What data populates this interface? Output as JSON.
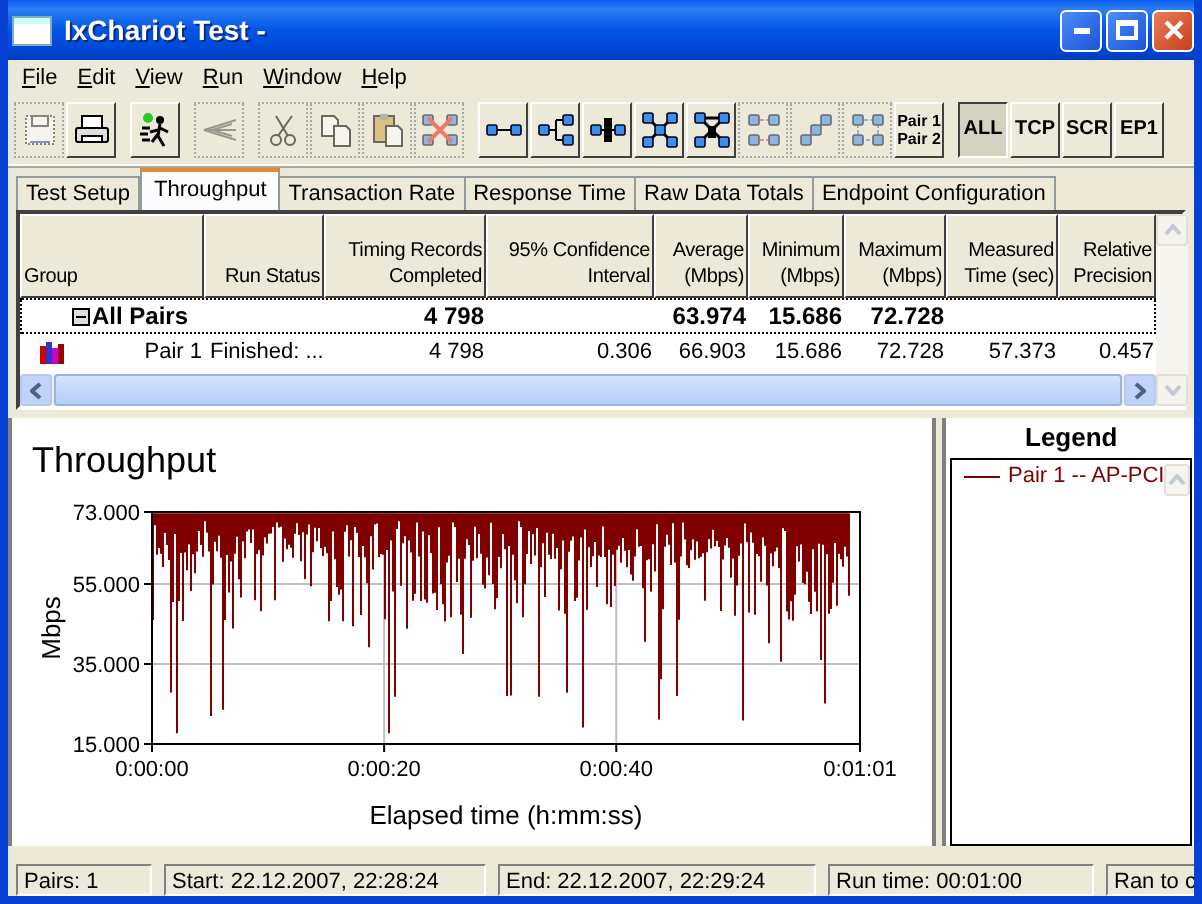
{
  "window": {
    "title": "IxChariot Test -"
  },
  "menu": [
    "File",
    "Edit",
    "View",
    "Run",
    "Window",
    "Help"
  ],
  "toolbar": [
    [
      {
        "kind": "icon",
        "disabled": true
      },
      {
        "kind": "icon",
        "disabled": false
      }
    ],
    [
      {
        "kind": "icon",
        "disabled": false
      }
    ],
    [
      {
        "kind": "icon",
        "disabled": true
      }
    ],
    [
      {
        "kind": "icon",
        "disabled": true
      },
      {
        "kind": "icon",
        "disabled": true
      },
      {
        "kind": "icon",
        "disabled": true
      },
      {
        "kind": "icon",
        "disabled": true
      }
    ],
    [
      {
        "kind": "icon",
        "disabled": false
      },
      {
        "kind": "icon",
        "disabled": false
      },
      {
        "kind": "icon",
        "disabled": false
      },
      {
        "kind": "icon",
        "disabled": false
      },
      {
        "kind": "icon",
        "disabled": false
      },
      {
        "kind": "icon",
        "disabled": true
      },
      {
        "kind": "icon",
        "disabled": true
      },
      {
        "kind": "icon",
        "disabled": true
      },
      {
        "kind": "text",
        "label": "Pair 1 Pair 2",
        "pressed": false
      }
    ],
    [
      {
        "kind": "text",
        "label": "ALL",
        "pressed": true
      },
      {
        "kind": "text",
        "label": "TCP",
        "pressed": false
      },
      {
        "kind": "text",
        "label": "SCR",
        "pressed": false
      },
      {
        "kind": "text",
        "label": "EP1",
        "pressed": false
      }
    ]
  ],
  "tabs": [
    {
      "label": "Test Setup",
      "selected": false
    },
    {
      "label": "Throughput",
      "selected": true
    },
    {
      "label": "Transaction Rate",
      "selected": false
    },
    {
      "label": "Response Time",
      "selected": false
    },
    {
      "label": "Raw Data Totals",
      "selected": false
    },
    {
      "label": "Endpoint Configuration",
      "selected": false
    }
  ],
  "table": {
    "columns": [
      "Group",
      "Run Status",
      "Timing Records Completed",
      "95% Confidence Interval",
      "Average (Mbps)",
      "Minimum (Mbps)",
      "Maximum (Mbps)",
      "Measured Time (sec)",
      "Relative Precision"
    ],
    "rows": [
      {
        "kind": "group",
        "expanded": true,
        "selected": true,
        "cells": [
          "All Pairs",
          null,
          "4 798",
          null,
          "63.974",
          "15.686",
          "72.728",
          null,
          null
        ]
      },
      {
        "kind": "pair",
        "selected": false,
        "cells": [
          "Pair 1",
          "Finished: ...",
          "4 798",
          "0.306",
          "66.903",
          "15.686",
          "72.728",
          "57.373",
          "0.457"
        ]
      }
    ]
  },
  "chart": {
    "title": "Throughput",
    "ylabel": "Mbps",
    "xlabel": "Elapsed time (h:mm:ss)",
    "yticks": [
      "73.000",
      "55.000",
      "35.000",
      "15.000"
    ],
    "xticks": [
      "0:00:00",
      "0:00:20",
      "0:00:40",
      "0:01:01"
    ]
  },
  "legend": {
    "title": "Legend",
    "items": [
      {
        "label": "Pair 1 -- AP-PCI",
        "color": "#800000"
      }
    ]
  },
  "status_bar": [
    "Pairs: 1",
    "Start: 22.12.2007, 22:28:24",
    "End: 22.12.2007, 22:29:24",
    "Run time: 00:01:00",
    "Ran to c"
  ]
}
